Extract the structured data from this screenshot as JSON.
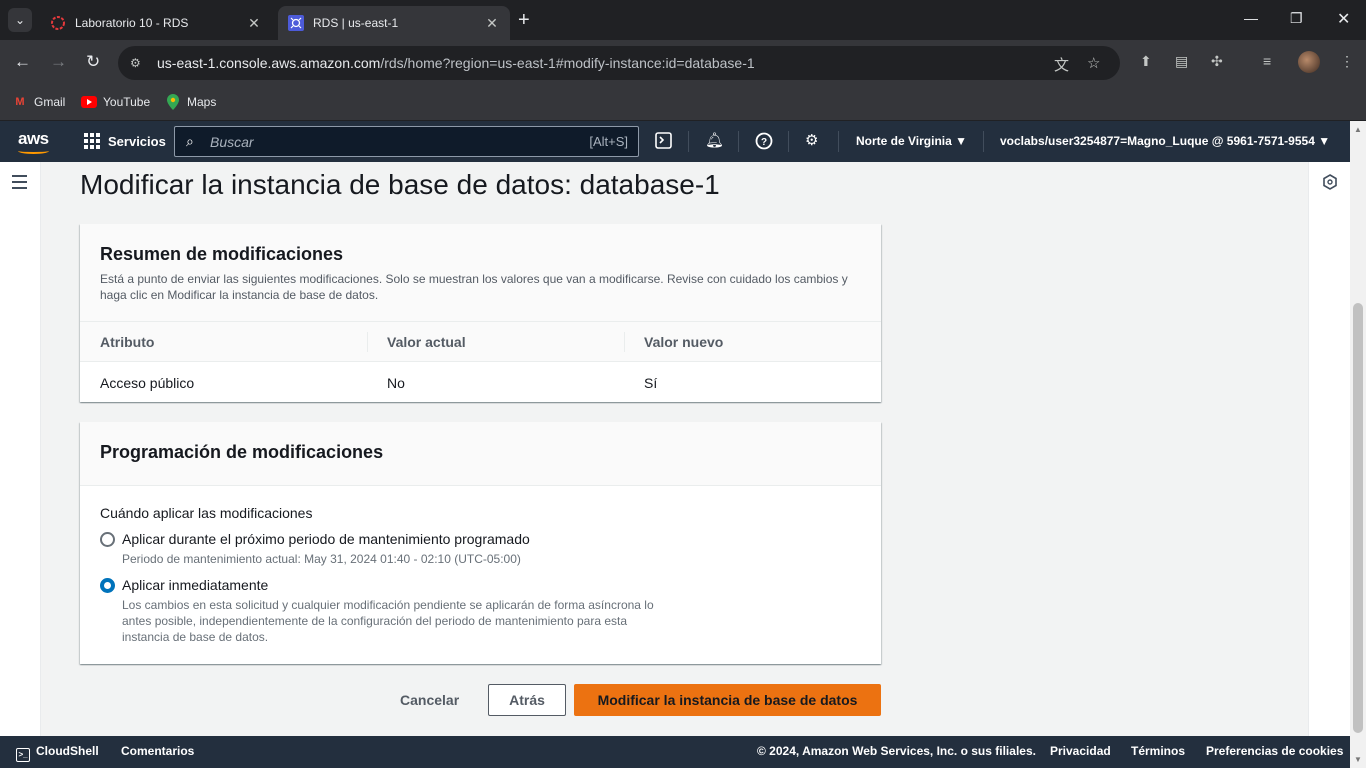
{
  "browser": {
    "tabs": [
      {
        "title": "Laboratorio 10 - RDS",
        "active": false,
        "icon": "canvas-icon"
      },
      {
        "title": "RDS | us-east-1",
        "active": true,
        "icon": "rds-icon"
      }
    ],
    "url_host": "us-east-1.console.aws.amazon.com",
    "url_path": "/rds/home?region=us-east-1#modify-instance:id=database-1",
    "bookmarks": [
      {
        "label": "Gmail",
        "icon": "gmail-icon"
      },
      {
        "label": "YouTube",
        "icon": "youtube-icon"
      },
      {
        "label": "Maps",
        "icon": "maps-icon"
      }
    ]
  },
  "aws_header": {
    "logo": "aws",
    "services_label": "Servicios",
    "search_placeholder": "Buscar",
    "search_shortcut": "[Alt+S]",
    "region": "Norte de Virginia",
    "account": "voclabs/user3254877=Magno_Luque @ 5961-7571-9554"
  },
  "page": {
    "title": "Modificar la instancia de base de datos: database-1"
  },
  "summary": {
    "title": "Resumen de modificaciones",
    "description": "Está a punto de enviar las siguientes modificaciones. Solo se muestran los valores que van a modificarse. Revise con cuidado los cambios y haga clic en Modificar la instancia de base de datos.",
    "columns": [
      "Atributo",
      "Valor actual",
      "Valor nuevo"
    ],
    "rows": [
      [
        "Acceso público",
        "No",
        "Sí"
      ]
    ]
  },
  "scheduling": {
    "title": "Programación de modificaciones",
    "field_label": "Cuándo aplicar las modificaciones",
    "options": [
      {
        "label": "Aplicar durante el próximo periodo de mantenimiento programado",
        "description": "Periodo de mantenimiento actual: May 31, 2024 01:40 - 02:10 (UTC-05:00)",
        "checked": false
      },
      {
        "label": "Aplicar inmediatamente",
        "description": "Los cambios en esta solicitud y cualquier modificación pendiente se aplicarán de forma asíncrona lo antes posible, independientemente de la configuración del periodo de mantenimiento para esta instancia de base de datos.",
        "checked": true
      }
    ]
  },
  "actions": {
    "cancel": "Cancelar",
    "back": "Atrás",
    "submit": "Modificar la instancia de base de datos"
  },
  "footer": {
    "cloudshell": "CloudShell",
    "feedback": "Comentarios",
    "copyright": "© 2024, Amazon Web Services, Inc. o sus filiales.",
    "privacy": "Privacidad",
    "terms": "Términos",
    "cookies": "Preferencias de cookies"
  },
  "colors": {
    "aws_nav": "#232f3e",
    "primary_button": "#ec7211",
    "radio_selected": "#0073bb"
  }
}
